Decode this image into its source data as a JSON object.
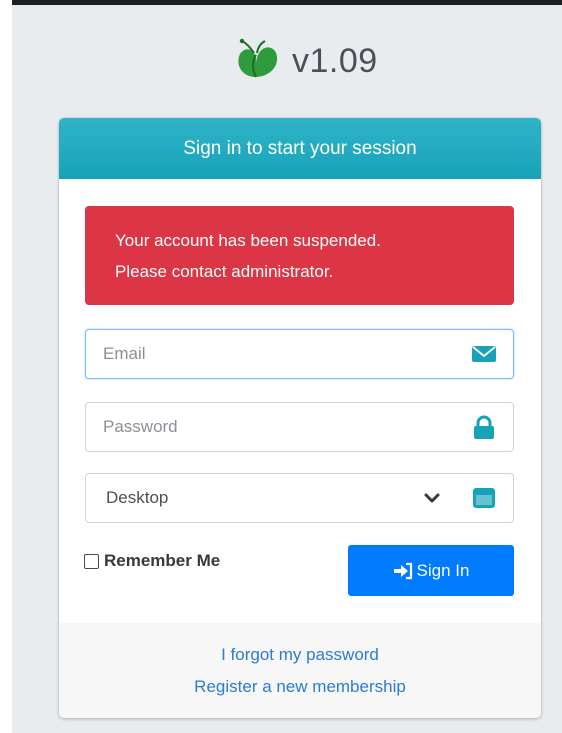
{
  "brand": {
    "version": "v1.09",
    "logo_icon": "butterfly-leaf-icon"
  },
  "card": {
    "header": "Sign in to start your session",
    "alert": {
      "line1": "Your account has been suspended.",
      "line2": "Please contact administrator.",
      "color": "#dc3545"
    },
    "email": {
      "placeholder": "Email",
      "value": "",
      "icon": "envelope-icon"
    },
    "password": {
      "placeholder": "Password",
      "value": "",
      "icon": "lock-icon"
    },
    "device": {
      "selected": "Desktop",
      "icon": "window-icon"
    },
    "remember_label": "Remember Me",
    "remember_checked": false,
    "signin_label": "Sign In",
    "forgot_link": "I forgot my password",
    "register_link": "Register a new membership"
  },
  "colors": {
    "header": "#17a2b8",
    "primary": "#007bff",
    "link": "#2b7bd6"
  }
}
